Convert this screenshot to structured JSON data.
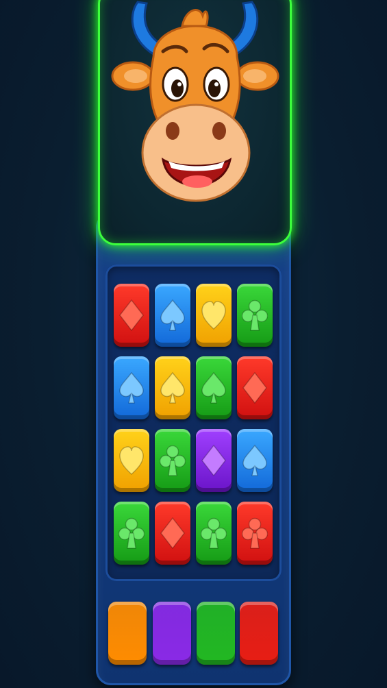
{
  "colors": {
    "red": "#e81e14",
    "blue": "#2a8cf0",
    "yellow": "#ffc20e",
    "green": "#22b822",
    "purple": "#8a2ae6",
    "orange": "#ff8c00",
    "frame_glow": "#3cff3c",
    "panel": "#15408a"
  },
  "mascot": {
    "icon": "cartoon-bull-head-icon"
  },
  "board": {
    "rows": [
      [
        {
          "color": "red",
          "suit": "diamond"
        },
        {
          "color": "blue",
          "suit": "spade"
        },
        {
          "color": "yellow",
          "suit": "heart"
        },
        {
          "color": "green",
          "suit": "club"
        }
      ],
      [
        {
          "color": "blue",
          "suit": "spade"
        },
        {
          "color": "yellow",
          "suit": "spade"
        },
        {
          "color": "green",
          "suit": "spade"
        },
        {
          "color": "red",
          "suit": "diamond"
        }
      ],
      [
        {
          "color": "yellow",
          "suit": "heart"
        },
        {
          "color": "green",
          "suit": "club"
        },
        {
          "color": "purple",
          "suit": "diamond"
        },
        {
          "color": "blue",
          "suit": "spade"
        }
      ],
      [
        {
          "color": "green",
          "suit": "club"
        },
        {
          "color": "red",
          "suit": "diamond"
        },
        {
          "color": "green",
          "suit": "club"
        },
        {
          "color": "red",
          "suit": "club"
        }
      ]
    ]
  },
  "palette": [
    "orange",
    "purple",
    "green",
    "red"
  ]
}
